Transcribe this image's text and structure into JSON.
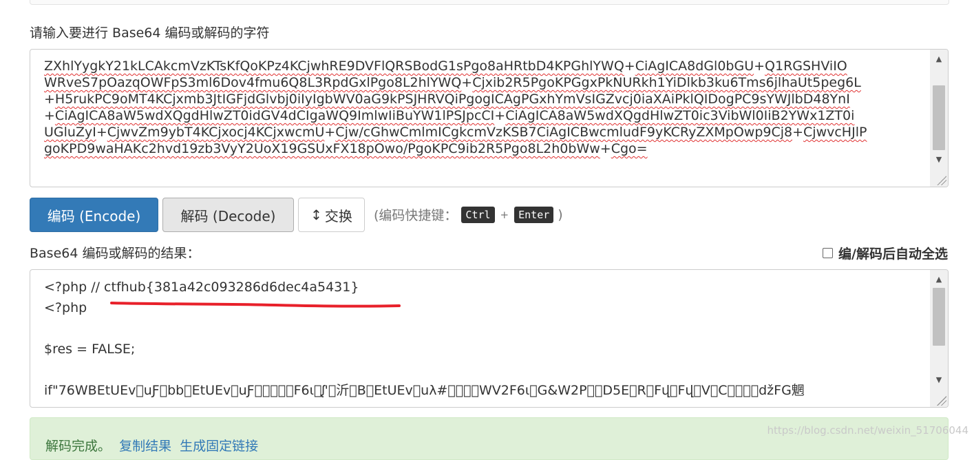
{
  "input_section": {
    "label": "请输入要进行 Base64 编码或解码的字符",
    "lines": [
      [
        {
          "t": "ZXhlYygkY21kLCAkcmVzKTsKfQoKPz4KCjwhRE9DVFlQRSBodG1sPgo8aHRtbD4KPGhlYWQ",
          "u": true
        },
        {
          "t": "+",
          "u": false
        },
        {
          "t": "CiAgICA8dGl0bGU",
          "u": true
        },
        {
          "t": "+",
          "u": false
        },
        {
          "t": "Q1RGSHViIO",
          "u": true
        }
      ],
      [
        {
          "t": "WRveS7pOazqOWFpS3ml6Dov4fmu6Q8L3RpdGxlPgo8L2hlYWQ",
          "u": true
        },
        {
          "t": "+",
          "u": false
        },
        {
          "t": "Cjxib2R5PgoKPGgxPkNURkh1YiDlkb3ku6Tms6jlhaUt5peg6L",
          "u": true
        }
      ],
      [
        {
          "t": "+",
          "u": false
        },
        {
          "t": "H5rukPC9oMT4KCjxmb3JtIGFjdGlvbj0iIyIgbWV0aG9kPSJHRVQiPgogICAgPGxhYmVsIGZvcj0iaXAiPklQIDogPC9sYWJlbD48YnI",
          "u": true
        }
      ],
      [
        {
          "t": "+",
          "u": false
        },
        {
          "t": "CiAgICA8aW5wdXQgdHlwZT0idGV4dCIgaWQ9ImlwIiBuYW1lPSJpcCI",
          "u": true
        },
        {
          "t": "+",
          "u": false
        },
        {
          "t": "CiAgICA8aW5wdXQgdHlwZT0ic3VibWl0IiB2YWx1ZT0i",
          "u": true
        }
      ],
      [
        {
          "t": "UGluZyI",
          "u": true
        },
        {
          "t": "+",
          "u": false
        },
        {
          "t": "CjwvZm9ybT4KCjxocj4KCjxwcmU",
          "u": true
        },
        {
          "t": "+",
          "u": false
        },
        {
          "t": "Cjw/cGhwCmlmICgkcmVzKSB7CiAgICBwcmludF9yKCRyZXMpOwp9Cj8",
          "u": true
        },
        {
          "t": "+",
          "u": false
        },
        {
          "t": "CjwvcHJlP",
          "u": true
        }
      ],
      [
        {
          "t": "goKPD9waHAKc2hvd19zb3VyY2UoX19GSUxFX18pOwo/PgoKPC9ib2R5Pgo8L2h0bWw",
          "u": true
        },
        {
          "t": "+",
          "u": false
        },
        {
          "t": "Cgo=",
          "u": true
        }
      ]
    ]
  },
  "buttons": {
    "encode": "编码 (Encode)",
    "decode": "解码 (Decode)",
    "swap": "交换",
    "swap_icon": "↕"
  },
  "shortcut": {
    "prefix": "(编码快捷键：",
    "key1": "Ctrl",
    "plus": "+",
    "key2": "Enter",
    "suffix": ")"
  },
  "output_section": {
    "label": "Base64 编码或解码的结果：",
    "autoselect_label": "编/解码后自动全选",
    "lines": [
      "<?php // ctfhub{381a42c093286d6dec4a5431}",
      "<?php",
      "",
      "$res = FALSE;",
      "",
      "if\"76WBEtUEv\u0000uƑ\u0000bb\u0000EtUEv\u0000uƑ\u0000\u0000\u0000\u0000\u0000F6ɩ\u0000ᶘ'\u0000沂\u0000B\u0000EtUEv\u0000uλ#\u0000\u0000\u0000\u0000WV2F6ɩ\u0000G&W2P\u0000\u0000D5E\u0000R\u0000Fվ\u0000Fվ\u0000V\u0000C\u0000\u0000\u0000\u0000džFG魍"
    ]
  },
  "status": {
    "message": "解码完成。",
    "copy_link": "复制结果",
    "fixed_link": "生成固定链接"
  },
  "watermark": "https://blog.csdn.net/weixin_51706044",
  "colors": {
    "primary": "#337ab7",
    "success_bg": "#dff0d8",
    "success_text": "#3c763d",
    "annotation_red": "#e8202a"
  }
}
